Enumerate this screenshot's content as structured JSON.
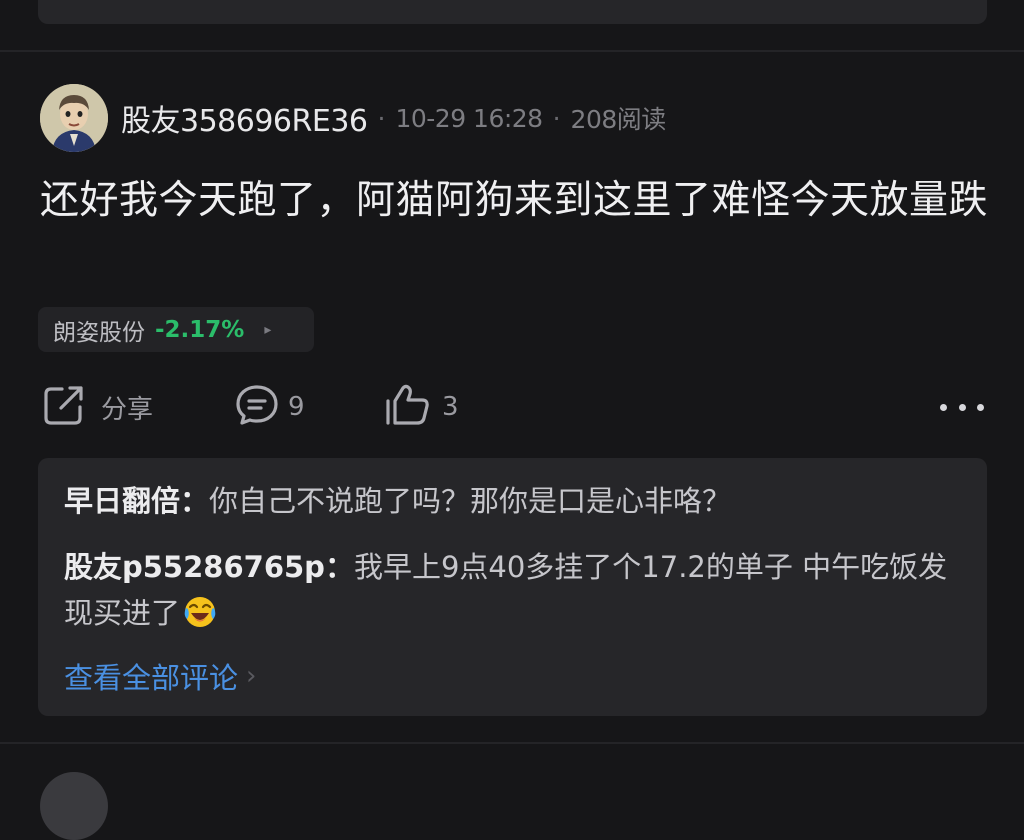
{
  "post": {
    "username": "股友358696RE36",
    "date": "10-29 16:28",
    "reads": "208阅读",
    "separator": "·",
    "text": "还好我今天跑了，阿猫阿狗来到这里了难怪今天放量跌",
    "stock": {
      "name": "朗姿股份",
      "change": "-2.17%",
      "change_color": "#2bbd6a"
    }
  },
  "actions": {
    "share_label": "分享",
    "comment_count": "9",
    "like_count": "3"
  },
  "comments": [
    {
      "author": "早日翻倍：",
      "text": "你自己不说跑了吗？那你是口是心非咯？"
    },
    {
      "author": "股友p55286765p：",
      "text": "我早上9点40多挂了个17.2的单子 中午吃饭发现买进了"
    }
  ],
  "view_all_label": "查看全部评论",
  "view_all_chevron": "›",
  "stock_arrow": "▸",
  "icons": {
    "share": "share-icon",
    "comment": "comment-bubble-icon",
    "like": "thumbs-up-icon",
    "more": "more-dots-icon",
    "emoji": "laughing-crying-emoji"
  },
  "colors": {
    "background": "#161618",
    "card": "#262629",
    "link": "#4a90e2",
    "down": "#2bbd6a"
  }
}
